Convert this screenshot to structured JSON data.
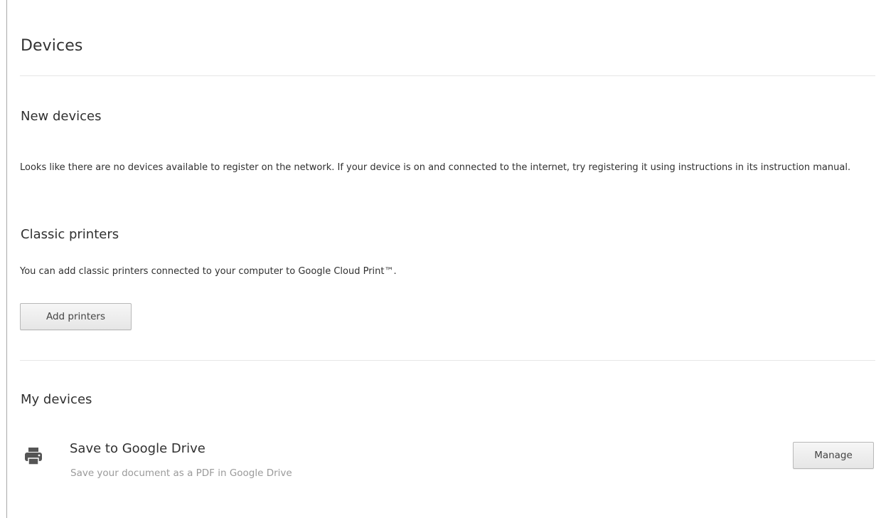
{
  "page": {
    "title": "Devices"
  },
  "new_devices": {
    "heading": "New devices",
    "message": "Looks like there are no devices available to register on the network. If your device is on and connected to the internet, try registering it using instructions in its instruction manual."
  },
  "classic_printers": {
    "heading": "Classic printers",
    "description": "You can add classic printers connected to your computer to Google Cloud Print™.",
    "add_button_label": "Add printers"
  },
  "my_devices": {
    "heading": "My devices",
    "items": [
      {
        "icon": "printer-icon",
        "name": "Save to Google Drive",
        "description": "Save your document as a PDF in Google Drive",
        "action_label": "Manage"
      }
    ]
  },
  "colors": {
    "text": "#303030",
    "muted_text": "#9a9a9a",
    "divider": "#e6e6e6",
    "icon": "#555555"
  }
}
